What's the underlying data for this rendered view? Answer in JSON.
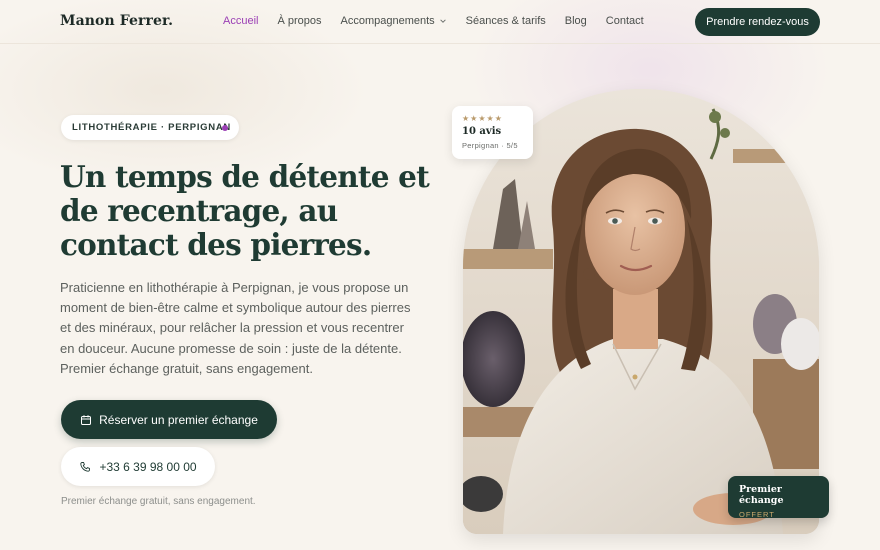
{
  "brand": {
    "name": "Manon Ferrer."
  },
  "nav": {
    "items": [
      {
        "label": "Accueil",
        "active": true
      },
      {
        "label": "À propos",
        "active": false
      },
      {
        "label": "Accompagnements",
        "active": false,
        "dropdown": true
      },
      {
        "label": "Séances & tarifs",
        "active": false
      },
      {
        "label": "Blog",
        "active": false
      },
      {
        "label": "Contact",
        "active": false
      }
    ],
    "cta_label": "Prendre rendez-vous"
  },
  "hero": {
    "badge": "LITHOTHÉRAPIE · PERPIGNAN",
    "title": "Un temps de détente et de recentrage, au contact des pierres.",
    "text": "Praticienne en lithothérapie à Perpignan, je vous propose un moment de bien-être calme et symbolique autour des pierres et des minéraux, pour relâcher la pression et vous recentrer en douceur. Aucune promesse de soin : juste de la détente. Premier échange gratuit, sans engagement.",
    "primary_button": "Réserver un premier échange",
    "phone_button": "+33 6 39 98 00 00",
    "footnote": "Premier échange gratuit, sans engagement."
  },
  "review": {
    "stars": "★★★★★",
    "count": "10 avis",
    "sub": "Perpignan · 5/5"
  },
  "offer": {
    "title": "Premier échange",
    "sub": "OFFERT"
  },
  "colors": {
    "accent": "#9b3fb5",
    "primary": "#1e3b33",
    "background": "#f8f4ee",
    "gold": "#c9a86c"
  }
}
